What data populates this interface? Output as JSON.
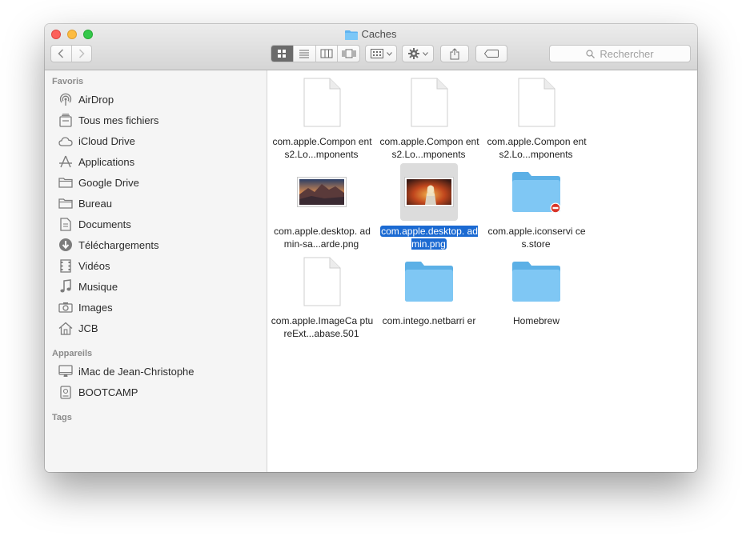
{
  "window": {
    "title": "Caches"
  },
  "toolbar": {
    "search_placeholder": "Rechercher"
  },
  "sidebar": {
    "sections": {
      "favorites": "Favoris",
      "devices": "Appareils",
      "tags": "Tags"
    },
    "favorites": [
      {
        "label": "AirDrop",
        "icon": "airdrop-icon"
      },
      {
        "label": "Tous mes fichiers",
        "icon": "all-files-icon"
      },
      {
        "label": "iCloud Drive",
        "icon": "cloud-icon"
      },
      {
        "label": "Applications",
        "icon": "applications-icon"
      },
      {
        "label": "Google Drive",
        "icon": "folder-icon"
      },
      {
        "label": "Bureau",
        "icon": "folder-icon"
      },
      {
        "label": "Documents",
        "icon": "document-icon"
      },
      {
        "label": "Téléchargements",
        "icon": "download-icon"
      },
      {
        "label": "Vidéos",
        "icon": "film-icon"
      },
      {
        "label": "Musique",
        "icon": "music-icon"
      },
      {
        "label": "Images",
        "icon": "camera-icon"
      },
      {
        "label": "JCB",
        "icon": "home-icon"
      }
    ],
    "devices": [
      {
        "label": "iMac de Jean-Christophe",
        "icon": "imac-icon"
      },
      {
        "label": "BOOTCAMP",
        "icon": "drive-icon"
      }
    ]
  },
  "files": [
    {
      "name": "com.apple.Compon ents2.Lo...mponents",
      "kind": "document"
    },
    {
      "name": "com.apple.Compon ents2.Lo...mponents",
      "kind": "document"
    },
    {
      "name": "com.apple.Compon ents2.Lo...mponents",
      "kind": "document"
    },
    {
      "name": "com.apple.desktop. admin-sa...arde.png",
      "kind": "image-mountains"
    },
    {
      "name": "com.apple.desktop. admin.png",
      "kind": "image-person",
      "selected": true
    },
    {
      "name": "com.apple.iconservi ces.store",
      "kind": "folder-restricted"
    },
    {
      "name": "com.apple.ImageCa ptureExt...abase.501",
      "kind": "document"
    },
    {
      "name": "com.intego.netbarri er",
      "kind": "folder"
    },
    {
      "name": "Homebrew",
      "kind": "folder"
    }
  ]
}
